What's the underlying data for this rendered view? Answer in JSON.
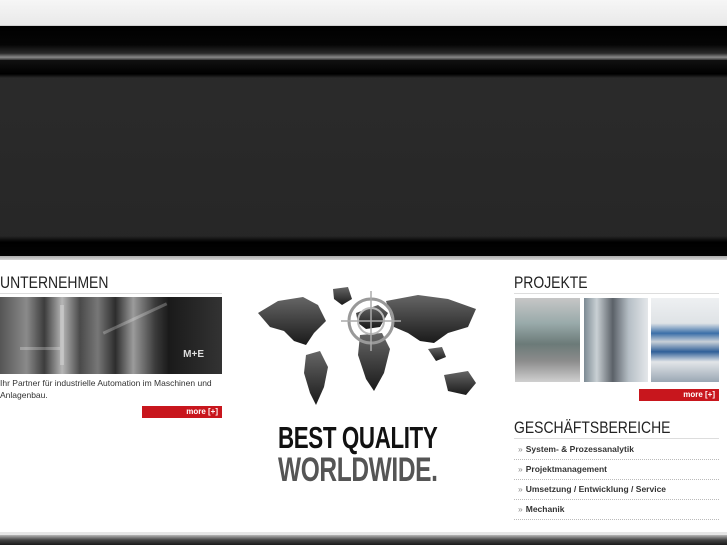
{
  "sections": {
    "unternehmen": {
      "title": "UNTERNEHMEN",
      "description": "Ihr Partner für industrielle Automation im Maschinen und Anlagenbau.",
      "more_label": "more [+]",
      "photo_logo": "M+E"
    },
    "projekte": {
      "title": "PROJEKTE",
      "more_label": "more [+]"
    },
    "geschaeftsbereiche": {
      "title_part1": "GESCHÄFTS",
      "title_part2": "BEREICHE",
      "arrow": "»",
      "items": [
        "System- & Prozessanalytik",
        "Projektmanagement",
        "Umsetzung / Entwicklung / Service",
        "Mechanik"
      ]
    }
  },
  "slogan": {
    "line1": "BEST QUALITY",
    "line2": "WORLDWIDE."
  },
  "colors": {
    "accent": "#c8161d",
    "banner": "#2b2b2b",
    "text": "#333333"
  }
}
